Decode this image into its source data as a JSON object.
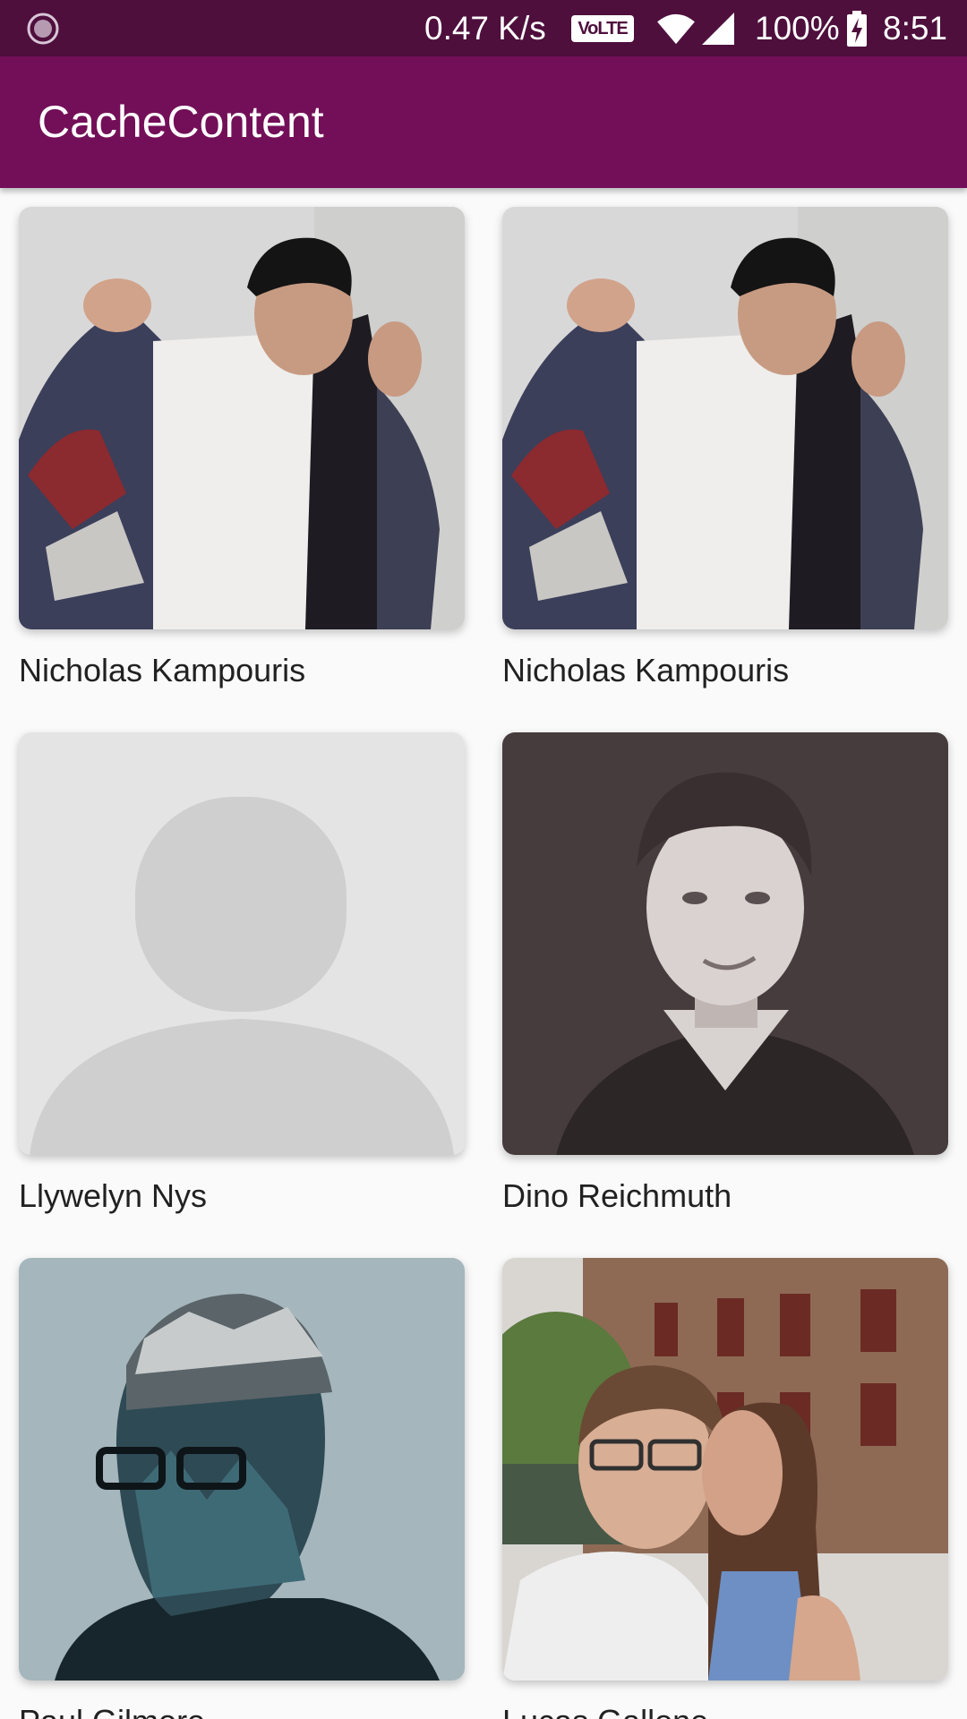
{
  "status_bar": {
    "network_speed": "0.47 K/s",
    "volte_label": "VoLTE",
    "battery_percent": "100%",
    "time": "8:51",
    "icons": [
      "notification-spinner-icon",
      "volte-icon",
      "wifi-icon",
      "signal-icon",
      "battery-charging-icon"
    ]
  },
  "app_bar": {
    "title": "CacheContent",
    "color": "#730f58"
  },
  "grid": {
    "items": [
      {
        "name": "Nicholas Kampouris",
        "image": "man-with-patterned-jacket"
      },
      {
        "name": "Nicholas Kampouris",
        "image": "man-with-patterned-jacket"
      },
      {
        "name": "Llywelyn Nys",
        "image": "placeholder-avatar"
      },
      {
        "name": "Dino Reichmuth",
        "image": "bw-portrait-smiling-man"
      },
      {
        "name": "Paul Gilmore",
        "image": "double-exposure-mountain-head"
      },
      {
        "name": "Lucas Gallone",
        "image": "couple-selfie-by-canal"
      }
    ]
  }
}
